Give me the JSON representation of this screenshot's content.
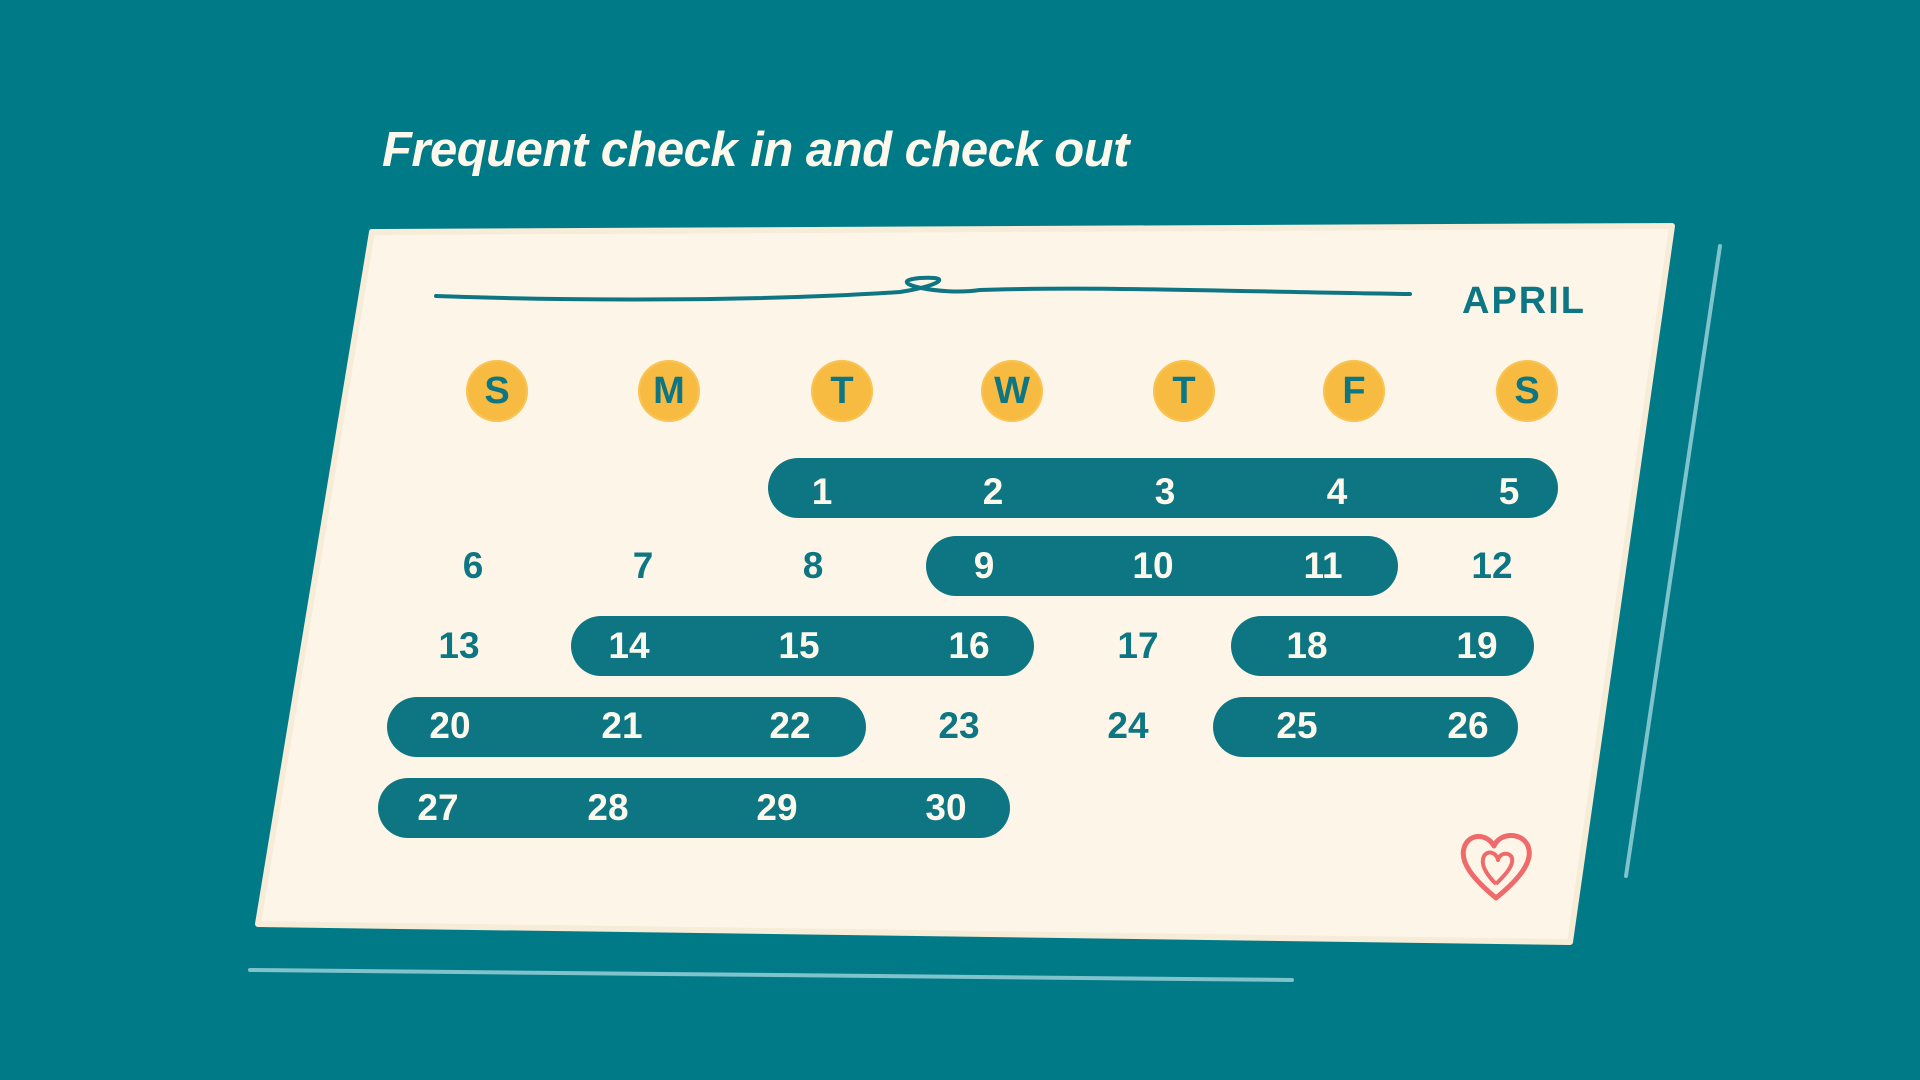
{
  "headline": "Frequent check in and check out",
  "calendar": {
    "month": "APRIL",
    "weekdays": [
      "S",
      "M",
      "T",
      "W",
      "T",
      "F",
      "S"
    ],
    "days": [
      "1",
      "2",
      "3",
      "4",
      "5",
      "6",
      "7",
      "8",
      "9",
      "10",
      "11",
      "12",
      "13",
      "14",
      "15",
      "16",
      "17",
      "18",
      "19",
      "20",
      "21",
      "22",
      "23",
      "24",
      "25",
      "26",
      "27",
      "28",
      "29",
      "30"
    ],
    "stays": [
      {
        "from": "1",
        "to": "5"
      },
      {
        "from": "9",
        "to": "11"
      },
      {
        "from": "14",
        "to": "16"
      },
      {
        "from": "18",
        "to": "19"
      },
      {
        "from": "20",
        "to": "22"
      },
      {
        "from": "25",
        "to": "26"
      },
      {
        "from": "27",
        "to": "30"
      }
    ]
  },
  "colors": {
    "background": "#007a87",
    "card": "#fdf6e8",
    "accent": "#0e7683",
    "weekday_dot": "#f8bb42",
    "heart": "#ef6a6a",
    "light_line": "#7fc3cc"
  },
  "icons": [
    "heart-logo-icon"
  ]
}
